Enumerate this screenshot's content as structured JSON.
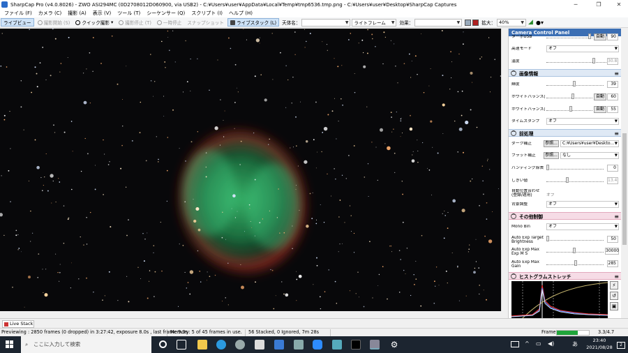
{
  "window": {
    "title": "SharpCap Pro (v4.0.8026) - ZWO ASI294MC (0D2708012D060900, via USB2) - C:¥Users¥user¥AppData¥Local¥Temp¥tmp6536.tmp.png - C:¥Users¥user¥Desktop¥SharpCap Captures",
    "minimize": "─",
    "maximize": "❐",
    "close": "✕"
  },
  "menu": [
    "ファイル (F)",
    "カメラ (C)",
    "撮影 (A)",
    "表示 (V)",
    "ツール (T)",
    "シーケンサー (Q)",
    "スクリプト (I)",
    "ヘルプ (H)"
  ],
  "toolbar": {
    "live_view": "ライブビュー",
    "start_capture": "撮影開始 (S)",
    "quick_capture": "クイック撮影",
    "stop_capture": "撮影停止 (T)",
    "pause": "一時停止",
    "snapshot": "スナップショット",
    "live_stack": "ライブスタック (L)",
    "target_label": "天体名：",
    "frame_type": "ライトフレーム",
    "effect_label": "効果：",
    "zoom_label": "拡大：",
    "zoom_value": "40%"
  },
  "panel": {
    "title": "Camera Control Panel",
    "top": {
      "turbo_label": "ターボUSB",
      "turbo_auto": "自動",
      "turbo_value": "90",
      "hs_label": "高速モード",
      "hs_value": "オフ",
      "temp_label": "温度",
      "temp_value": "30.8"
    },
    "image": {
      "header": "画像情報",
      "gamma_label": "輝度",
      "gamma_value": "39",
      "wbr_label": "ホワイトバランス(R)",
      "wbr_auto": "自動",
      "wbr_value": "60",
      "wbb_label": "ホワイトバランス(B)",
      "wbb_auto": "自動",
      "wbb_value": "55",
      "ts_label": "タイムスタンプ",
      "ts_value": "オフ"
    },
    "pre": {
      "header": "前処理",
      "dark_label": "ダーク補正",
      "dark_browse": "参照...",
      "dark_value": "C:¥Users¥user¥Deskto...",
      "flat_label": "フラット補正",
      "flat_browse": "参照...",
      "flat_value": "なし",
      "banding_label": "バンディング除去",
      "banding_value": "0",
      "thresh_label": "しきい値",
      "thresh_value": "13.4",
      "auto_align_label": "自動位置合わせ(登録/適用)",
      "auto_align_value": "オフ",
      "smooth_label": "背景調整",
      "smooth_value": "オフ"
    },
    "misc": {
      "header": "その他制御",
      "mono_label": "Mono Bin",
      "mono_value": "オフ",
      "aetb_label": "Auto Exp Target Brightness",
      "aetb_value": "50",
      "aeme_label": "Auto Exp Max Exp M S",
      "aeme_value": "30000",
      "aemg_label": "Auto Exp Max Gain",
      "aemg_value": "285"
    },
    "histo": {
      "header": "ヒストグラムストレッチ"
    }
  },
  "live_stack_tab": "Live Stack",
  "status": {
    "preview": "Previewing : 2850 frames (0 dropped) in 3:27:42, exposure 8.0s , last frame 9.3s",
    "memory": "Memory: 5 of 45 frames in use.",
    "stack": "56 Stacked, 0 Ignored, 7m 28s",
    "frame_label": "Frame:",
    "frame_fraction": 0.65,
    "frame_time": "3.3/4.7"
  },
  "taskbar": {
    "search_placeholder": "ここに入力して検索",
    "time": "23:40",
    "date": "2021/08/28",
    "ime": "あ",
    "notification_count": "2"
  },
  "colors": {
    "accent": "#3c6fb4",
    "nebula_green": "#33b86a",
    "nebula_red": "#b23a2a",
    "frame_bar": "#1fa53a"
  }
}
